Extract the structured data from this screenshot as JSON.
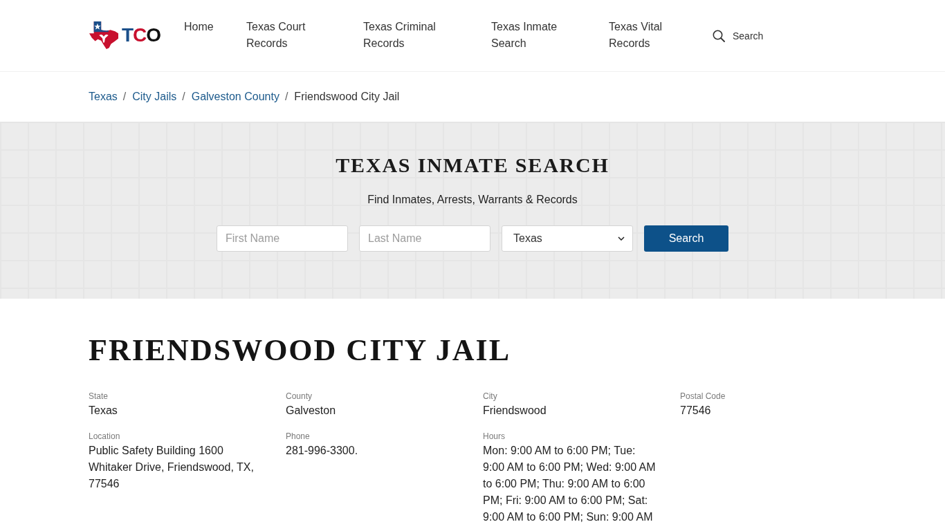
{
  "header": {
    "logo": {
      "text": "TCO"
    },
    "nav": [
      {
        "label": "Home"
      },
      {
        "label": "Texas Court Records"
      },
      {
        "label": "Texas Criminal Records"
      },
      {
        "label": "Texas Inmate Search"
      },
      {
        "label": "Texas Vital Records"
      }
    ],
    "search": {
      "label": "Search"
    }
  },
  "breadcrumb": [
    {
      "label": "Texas",
      "current": false,
      "separator": "/"
    },
    {
      "label": "City Jails",
      "current": false,
      "separator": "/"
    },
    {
      "label": "Galveston County",
      "current": false,
      "separator": "/"
    },
    {
      "label": "Friendswood City Jail",
      "current": true
    }
  ],
  "hero": {
    "title": "TEXAS INMATE SEARCH",
    "subtitle": "Find Inmates, Arrests, Warrants & Records",
    "first_name": {
      "placeholder": "First Name"
    },
    "last_name": {
      "placeholder": "Last Name"
    },
    "state": {
      "value": "Texas"
    },
    "button": "Search"
  },
  "facility": {
    "title": "FRIENDSWOOD CITY JAIL",
    "details": [
      {
        "label": "State",
        "value": "Texas"
      },
      {
        "label": "County",
        "value": "Galveston"
      },
      {
        "label": "City",
        "value": "Friendswood"
      },
      {
        "label": "Postal Code",
        "value": "77546"
      },
      {
        "label": "Location",
        "value": "Public Safety Building 1600 Whitaker Drive, Friendswood, TX, 77546"
      },
      {
        "label": "Phone",
        "value": "281-996-3300."
      },
      {
        "label": "Hours",
        "value": "Mon: 9:00 AM to 6:00 PM; Tue: 9:00 AM to 6:00 PM; Wed: 9:00 AM to 6:00 PM; Thu: 9:00 AM to 6:00 PM; Fri: 9:00 AM to 6:00 PM; Sat: 9:00 AM to 6:00 PM; Sun: 9:00 AM"
      }
    ]
  }
}
